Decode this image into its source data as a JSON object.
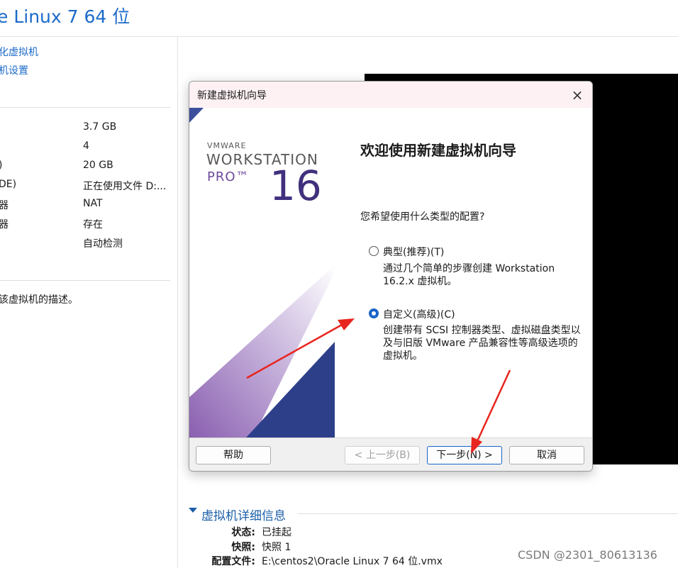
{
  "vm": {
    "title": "e Linux 7 64 位",
    "actions": [
      "化虚拟机",
      "机设置"
    ],
    "devices": [
      {
        "name": "",
        "value": "3.7 GB"
      },
      {
        "name": "",
        "value": "4"
      },
      {
        "name": ")",
        "value": "20 GB"
      },
      {
        "name": "DE)",
        "value": "正在使用文件 D:..."
      },
      {
        "name": "器",
        "value": "NAT"
      },
      {
        "name": "器",
        "value": "存在"
      },
      {
        "name": "",
        "value": "自动检测"
      }
    ],
    "description_hint": "该虚拟机的描述。"
  },
  "details": {
    "title": "虚拟机详细信息",
    "rows": [
      {
        "label": "状态:",
        "value": "已挂起"
      },
      {
        "label": "快照:",
        "value": "快照 1"
      },
      {
        "label": "配置文件:",
        "value": "E:\\centos2\\Oracle Linux 7 64 位.vmx"
      }
    ]
  },
  "dialog": {
    "title": "新建虚拟机向导",
    "close_icon": "×",
    "brand": {
      "vmware": "VMWARE",
      "product": "WORKSTATION",
      "edition": "PRO™",
      "version": "16"
    },
    "heading": "欢迎使用新建虚拟机向导",
    "question": "您希望使用什么类型的配置?",
    "options": [
      {
        "label": "典型(推荐)(T)",
        "desc": "通过几个简单的步骤创建 Workstation 16.2.x 虚拟机。",
        "selected": false
      },
      {
        "label": "自定义(高级)(C)",
        "desc": "创建带有 SCSI 控制器类型、虚拟磁盘类型以及与旧版 VMware 产品兼容性等高级选项的虚拟机。",
        "selected": true
      }
    ],
    "buttons": {
      "help": "帮助",
      "back": "< 上一步(B)",
      "next": "下一步(N) >",
      "cancel": "取消"
    }
  },
  "colors": {
    "accent": "#1a64c8",
    "link": "#1b6ac9",
    "annotation_arrow": "#e8251f",
    "brand_purple": "#41307d"
  },
  "watermark": "CSDN @2301_80613136"
}
